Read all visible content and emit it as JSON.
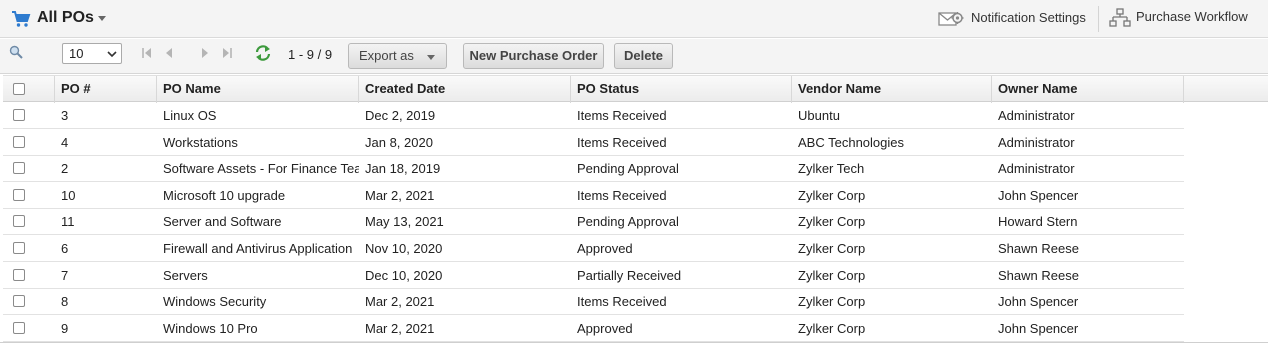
{
  "header": {
    "title": "All POs",
    "notification_label": "Notification Settings",
    "workflow_label": "Purchase Workflow",
    "icons": [
      "cart-icon",
      "chevron-down-icon",
      "notification-settings-icon",
      "workflow-icon"
    ]
  },
  "toolbar": {
    "page_size": "10",
    "page_range": "1 - 9 / 9",
    "export_label": "Export as",
    "new_label": "New Purchase Order",
    "delete_label": "Delete",
    "icons": [
      "search-icon",
      "first-page-icon",
      "prev-page-icon",
      "next-page-icon",
      "last-page-icon",
      "refresh-icon"
    ]
  },
  "table": {
    "columns": [
      "PO #",
      "PO Name",
      "Created Date",
      "PO Status",
      "Vendor Name",
      "Owner Name"
    ],
    "rows": [
      [
        "3",
        "Linux OS",
        "Dec 2, 2019",
        "Items Received",
        "Ubuntu",
        "Administrator"
      ],
      [
        "4",
        "Workstations",
        "Jan 8, 2020",
        "Items Received",
        "ABC Technologies",
        "Administrator"
      ],
      [
        "2",
        "Software Assets - For Finance Team",
        "Jan 18, 2019",
        "Pending Approval",
        "Zylker Tech",
        "Administrator"
      ],
      [
        "10",
        "Microsoft 10 upgrade",
        "Mar 2, 2021",
        "Items Received",
        "Zylker Corp",
        "John Spencer"
      ],
      [
        "11",
        "Server and Software",
        "May 13, 2021",
        "Pending Approval",
        "Zylker Corp",
        "Howard Stern"
      ],
      [
        "6",
        "Firewall and Antivirus Application",
        "Nov 10, 2020",
        "Approved",
        "Zylker Corp",
        "Shawn Reese"
      ],
      [
        "7",
        "Servers",
        "Dec 10, 2020",
        "Partially Received",
        "Zylker Corp",
        "Shawn Reese"
      ],
      [
        "8",
        "Windows Security",
        "Mar 2, 2021",
        "Items Received",
        "Zylker Corp",
        "John Spencer"
      ],
      [
        "9",
        "Windows 10 Pro",
        "Mar 2, 2021",
        "Approved",
        "Zylker Corp",
        "John Spencer"
      ]
    ]
  },
  "colors": {
    "accent": "#2e7bcf",
    "header_bg": "#f4f4f4"
  }
}
